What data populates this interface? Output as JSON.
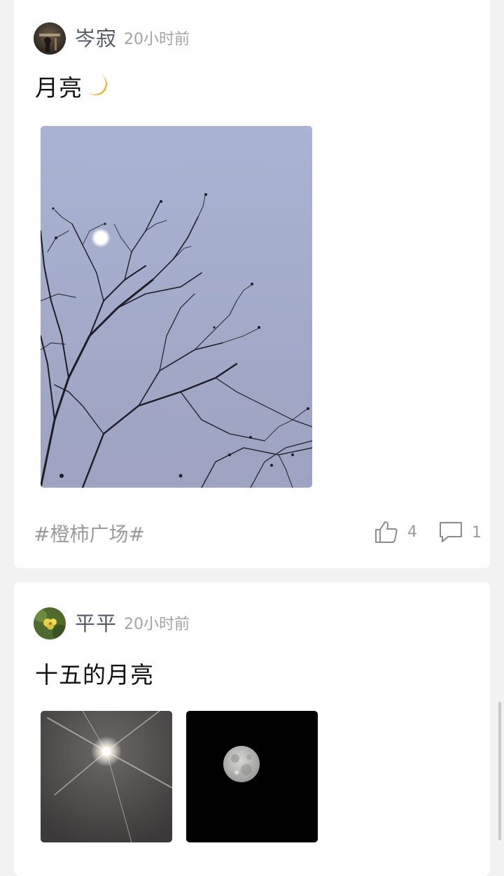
{
  "posts": [
    {
      "username": "岑寂",
      "time": "20小时前",
      "text": "月亮",
      "emoji": "crescent-moon-emoji",
      "topic": "#橙柿广场#",
      "likes": "4",
      "comments": "1"
    },
    {
      "username": "平平",
      "time": "20小时前",
      "text": "十五的月亮"
    }
  ],
  "icons": {
    "like": "thumbs-up-icon",
    "comment": "comment-icon"
  },
  "colors": {
    "background": "#f2f2f2",
    "card": "#ffffff",
    "username": "#555a66",
    "meta": "#a3a3a3",
    "sky": "#a8b2d2"
  }
}
